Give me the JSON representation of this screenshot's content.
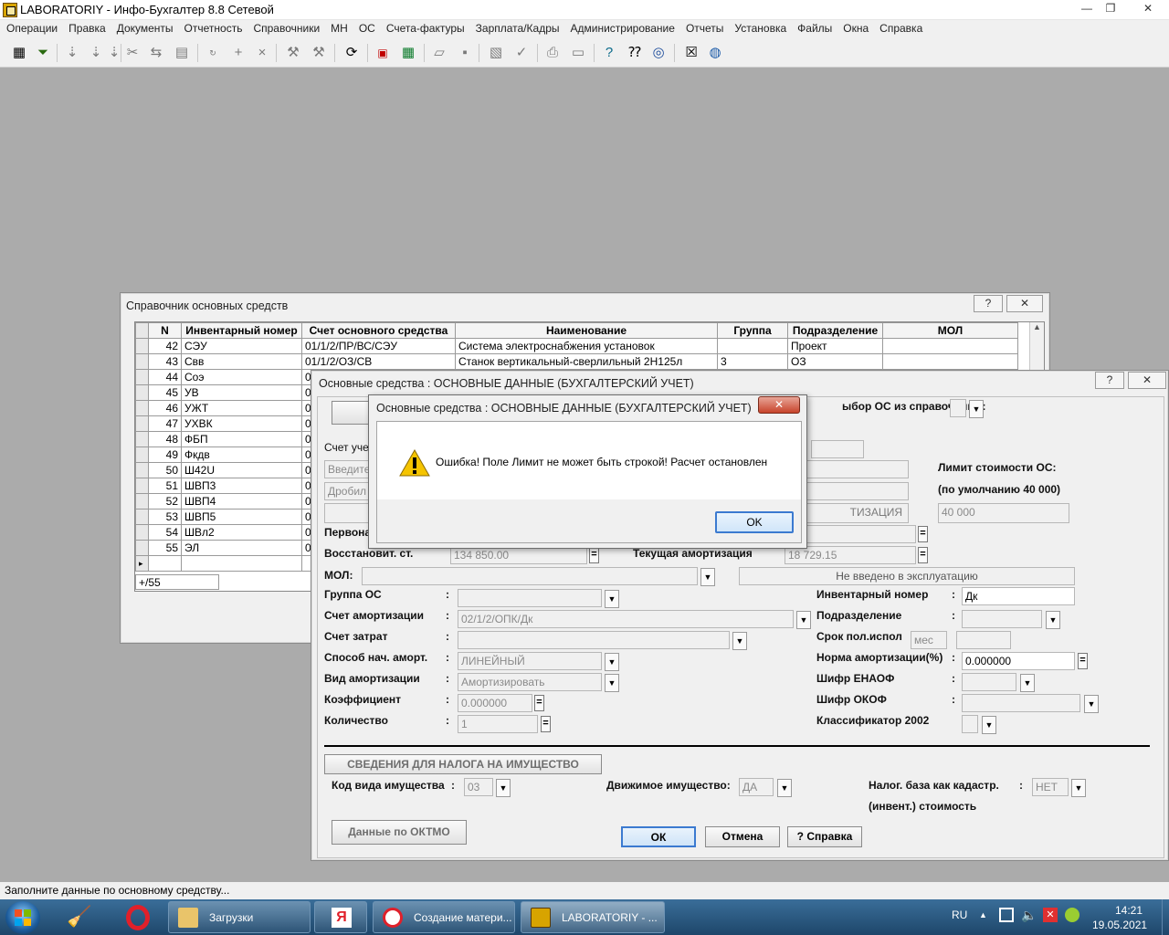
{
  "app": {
    "title": "LABORATORIY - Инфо-Бухгалтер 8.8 Сетевой",
    "min": "—",
    "max": "❐",
    "close": "✕"
  },
  "menu": [
    "Операции",
    "Правка",
    "Документы",
    "Отчетность",
    "Справочники",
    "МН",
    "ОС",
    "Счета-фактуры",
    "Зарплата/Кадры",
    "Администрирование",
    "Отчеты",
    "Установка",
    "Файлы",
    "Окна",
    "Справка"
  ],
  "toolbar_icons": [
    "table-grid-icon",
    "filter-icon",
    "sort-down-icon",
    "sort-down-2-icon",
    "sort-down-3-icon",
    "cut-icon",
    "paste-icon",
    "clipboard-icon",
    "rotate-icon",
    "add-icon",
    "delete-icon",
    "tool-icon",
    "tool-2-icon",
    "refresh-icon",
    "pdf-icon",
    "calculator-icon",
    "folder-open-icon",
    "save-icon",
    "print-preview-icon",
    "check-sign-icon",
    "printer-icon",
    "page-icon",
    "help-icon",
    "whats-this-icon",
    "compass-icon",
    "close-window-icon",
    "globe-icon"
  ],
  "directory": {
    "title": "Справочник основных средств",
    "help": "?",
    "close": "✕",
    "columns": [
      "N",
      "Инвентарный номер",
      "Счет основного средства",
      "Наименование",
      "Группа",
      "Подразделение",
      "МОЛ"
    ],
    "rows": [
      {
        "n": "42",
        "inv": "СЭУ",
        "acct": "01/1/2/ПР/ВС/СЭУ",
        "name": "Система электроснабжения установок",
        "group": "",
        "dept": "Проект",
        "mol": ""
      },
      {
        "n": "43",
        "inv": "Свв",
        "acct": "01/1/2/ОЗ/СВ",
        "name": "Станок вертикальный-сверлильный 2Н125л",
        "group": "3",
        "dept": "ОЗ",
        "mol": ""
      },
      {
        "n": "44",
        "inv": "Соэ",
        "acct": "0",
        "name": "",
        "group": "",
        "dept": "",
        "mol": ""
      },
      {
        "n": "45",
        "inv": "УВ",
        "acct": "0",
        "name": "",
        "group": "",
        "dept": "",
        "mol": ""
      },
      {
        "n": "46",
        "inv": "УЖТ",
        "acct": "0",
        "name": "",
        "group": "",
        "dept": "",
        "mol": ""
      },
      {
        "n": "47",
        "inv": "УХВК",
        "acct": "0",
        "name": "",
        "group": "",
        "dept": "",
        "mol": ""
      },
      {
        "n": "48",
        "inv": "ФБП",
        "acct": "0",
        "name": "",
        "group": "",
        "dept": "",
        "mol": ""
      },
      {
        "n": "49",
        "inv": "Фкдв",
        "acct": "0",
        "name": "",
        "group": "",
        "dept": "",
        "mol": ""
      },
      {
        "n": "50",
        "inv": "Ш42U",
        "acct": "0",
        "name": "",
        "group": "",
        "dept": "",
        "mol": ""
      },
      {
        "n": "51",
        "inv": "ШВП3",
        "acct": "0",
        "name": "",
        "group": "",
        "dept": "",
        "mol": ""
      },
      {
        "n": "52",
        "inv": "ШВП4",
        "acct": "0",
        "name": "",
        "group": "",
        "dept": "",
        "mol": ""
      },
      {
        "n": "53",
        "inv": "ШВП5",
        "acct": "0",
        "name": "",
        "group": "",
        "dept": "",
        "mol": ""
      },
      {
        "n": "54",
        "inv": "ШВл2",
        "acct": "0",
        "name": "",
        "group": "",
        "dept": "",
        "mol": ""
      },
      {
        "n": "55",
        "inv": "ЭЛ",
        "acct": "0",
        "name": "",
        "group": "",
        "dept": "",
        "mol": ""
      }
    ],
    "footer_count": "+/55"
  },
  "form": {
    "title": "Основные средства : ОСНОВНЫЕ ДАННЫЕ (БУХГАЛТЕРСКИЙ УЧЕТ)",
    "select_from_dir": "ыбор ОС из справочника :",
    "acct_label": "Счет уче",
    "enter_placeholder": "Введите",
    "split_placeholder": "Дробил",
    "initial_label": "Первона",
    "restore_label": "Восстановит.  ст.",
    "restore_value": "134 850.00",
    "current_amort_label": "Текущая   амортизация",
    "current_amort_value": "18 729.15",
    "amort_section_label": "ТИЗАЦИЯ",
    "limit_label_1": "Лимит стоимости ОС:",
    "limit_label_2": "(по умолчанию 40 000)",
    "limit_value": "40 000",
    "mol_label": "МОЛ:",
    "status_not_in_use": "Не введено в эксплуатацию",
    "group_label": "Группа ОС",
    "amort_acct_label": "Счет амортизации",
    "amort_acct_value": "02/1/2/ОПК/Дк",
    "cost_acct_label": "Счет затрат",
    "method_label": "Способ нач. аморт.",
    "method_value": "ЛИНЕЙНЫЙ",
    "amort_type_label": "Вид амортизации",
    "amort_type_value": "Амортизировать",
    "coef_label": "Коэффициент",
    "coef_value": "0.000000",
    "qty_label": "Количество",
    "qty_value": "1",
    "inv_label": "Инвентарный номер",
    "inv_value": "Дк",
    "dept_label": "Подразделение",
    "useful_life_label": "Срок пол.испол",
    "useful_life_unit": "мес",
    "norm_label": "Норма амортизации(%)",
    "norm_value": "0.000000",
    "enaof_label": "Шифр ЕНАОФ",
    "okof_label": "Шифр ОКОФ",
    "classifier_label": "Классификатор 2002",
    "colon": ":",
    "tax_section": "СВЕДЕНИЯ ДЛЯ НАЛОГА НА ИМУЩЕСТВО",
    "property_code_label": "Код вида имущества",
    "property_code_value": "03",
    "movable_label": "Движимое имущество:",
    "movable_value": "ДА",
    "cadastral_label_1": "Налог. база как кадастр.",
    "cadastral_label_2": "(инвент.) стоимость",
    "cadastral_value": "НЕТ",
    "oktmo_button": "Данные по ОКТМО",
    "ok_button": "ОК",
    "cancel_button": "Отмена",
    "help_button": "? Справка",
    "help": "?",
    "close": "✕"
  },
  "error_dialog": {
    "title": "Основные средства : ОСНОВНЫЕ ДАННЫЕ (БУХГАЛТЕРСКИЙ УЧЕТ)",
    "message": "Ошибка! Поле Лимит не может быть строкой! Расчет остановлен",
    "ok_button": "OK",
    "close": "✕"
  },
  "status_bar": "Заполните данные по основному средству...",
  "taskbar": {
    "items": [
      {
        "label": "Загрузки"
      },
      {
        "label": "Создание матери..."
      },
      {
        "label": "LABORATORIY - ..."
      }
    ],
    "yandex_letter": "Я",
    "lang": "RU",
    "tray_up": "▲",
    "time": "14:21",
    "date": "19.05.2021",
    "colors": {
      "bar": "#2a5a85",
      "accent": "#3a6e99"
    }
  }
}
